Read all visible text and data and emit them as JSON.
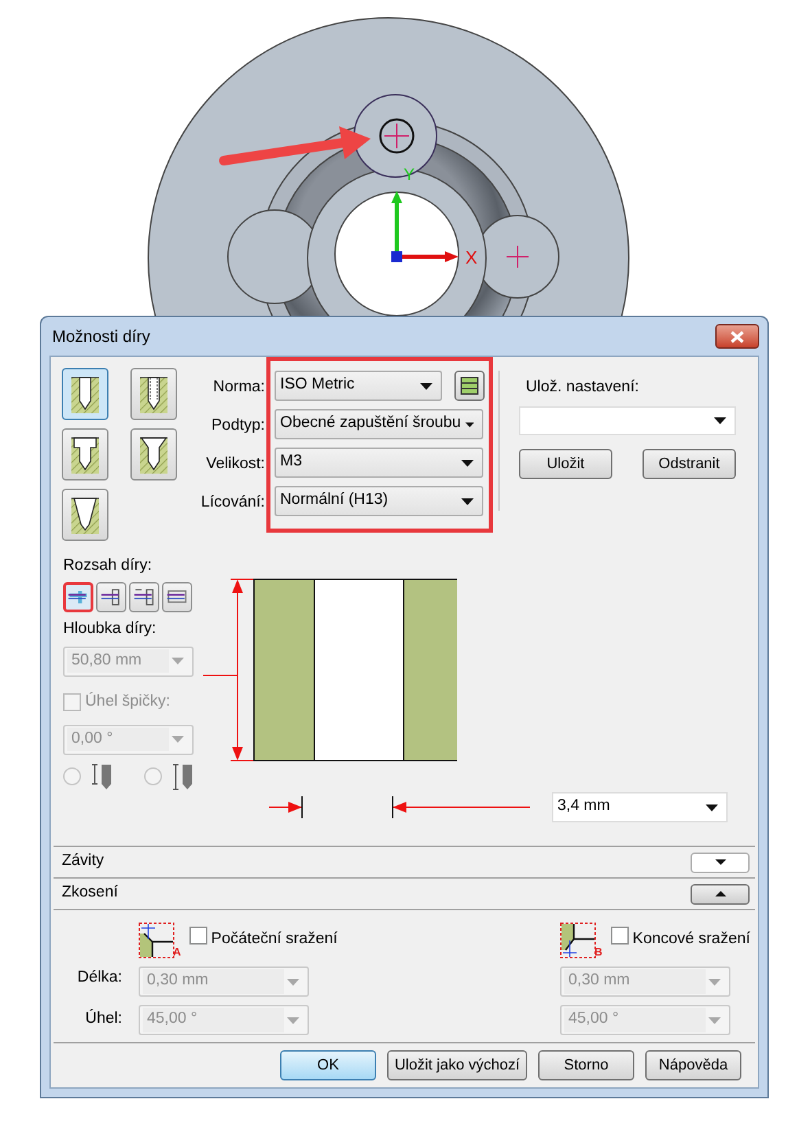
{
  "viewport": {
    "axis_x": "X",
    "axis_y": "Y"
  },
  "dialog": {
    "title": "Možnosti díry"
  },
  "hole_types": [
    {
      "kind": "simple",
      "selected": true
    },
    {
      "kind": "threaded",
      "selected": false
    },
    {
      "kind": "counterbore",
      "selected": false
    },
    {
      "kind": "countersink",
      "selected": false
    },
    {
      "kind": "tapered",
      "selected": false
    }
  ],
  "fields": [
    {
      "label": "Norma:",
      "value": "ISO Metric",
      "kind": "with_table"
    },
    {
      "label": "Podtyp:",
      "value": "Obecné zapuštění šroubu",
      "kind": "plain"
    },
    {
      "label": "Velikost:",
      "value": "M3",
      "kind": "plain"
    },
    {
      "label": "Lícování:",
      "value": "Normální (H13)",
      "kind": "plain"
    }
  ],
  "saved_settings": {
    "label": "Ulož. nastavení:",
    "buttons": [
      "Uložit",
      "Odstranit"
    ]
  },
  "extent": {
    "label": "Rozsah díry:",
    "options": [
      {
        "kind": "finite",
        "selected": true
      },
      {
        "kind": "through_next",
        "selected": false
      },
      {
        "kind": "from_to",
        "selected": false
      },
      {
        "kind": "through_all",
        "selected": false
      }
    ]
  },
  "depth": {
    "label": "Hloubka díry:",
    "value": "50,80 mm",
    "disabled": true
  },
  "tip_angle": {
    "label": "Úhel špičky:",
    "checked": false,
    "disabled": true,
    "value": "0,00 °"
  },
  "tip_options": [
    {
      "kind": "to_shoulder",
      "selected": false,
      "disabled": true
    },
    {
      "kind": "to_tip",
      "selected": false,
      "disabled": true
    }
  ],
  "diameter": {
    "value": "3,4 mm"
  },
  "sections": [
    {
      "title": "Závity",
      "expanded": false
    },
    {
      "title": "Zkosení",
      "expanded": true
    }
  ],
  "chamfer_labels": [
    "Délka:",
    "Úhel:"
  ],
  "chamfers": [
    {
      "label": "Počáteční sražení",
      "marker": "A",
      "checked": false,
      "length": "0,30 mm",
      "angle": "45,00 °",
      "disabled": true
    },
    {
      "label": "Koncové sražení",
      "marker": "B",
      "checked": false,
      "length": "0,30 mm",
      "angle": "45,00 °",
      "disabled": true
    }
  ],
  "buttons": [
    {
      "label": "OK",
      "default": true
    },
    {
      "label": "Uložit jako výchozí",
      "default": false
    },
    {
      "label": "Storno",
      "default": false
    },
    {
      "label": "Nápověda",
      "default": false
    }
  ]
}
